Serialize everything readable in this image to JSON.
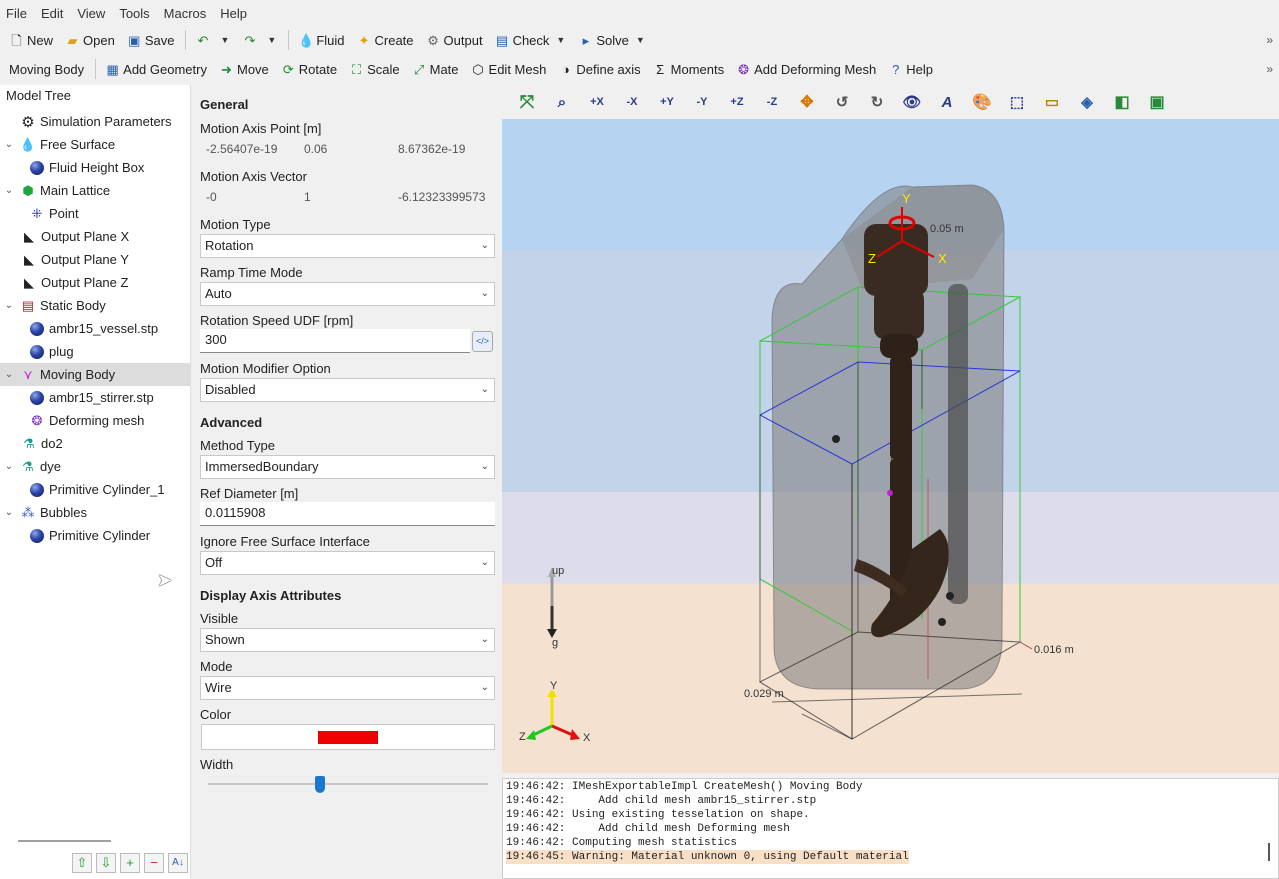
{
  "menu": [
    "File",
    "Edit",
    "View",
    "Tools",
    "Macros",
    "Help"
  ],
  "toolbar1": {
    "new": "New",
    "open": "Open",
    "save": "Save",
    "fluid": "Fluid",
    "create": "Create",
    "output": "Output",
    "check": "Check",
    "solve": "Solve"
  },
  "toolbar2": {
    "context": "Moving Body",
    "add_geometry": "Add Geometry",
    "move": "Move",
    "rotate": "Rotate",
    "scale": "Scale",
    "mate": "Mate",
    "edit_mesh": "Edit Mesh",
    "define_axis": "Define axis",
    "moments": "Moments",
    "add_deforming_mesh": "Add Deforming Mesh",
    "help": "Help"
  },
  "tree": {
    "title": "Model Tree",
    "items": [
      {
        "label": "Simulation Parameters",
        "icon": "gear-icon"
      },
      {
        "label": "Free Surface",
        "icon": "free-surface-icon"
      },
      {
        "label": "Fluid Height Box",
        "icon": "sphere-icon"
      },
      {
        "label": "Main Lattice",
        "icon": "lattice-icon"
      },
      {
        "label": "Point",
        "icon": "point-icon"
      },
      {
        "label": "Output Plane X",
        "icon": "plane-icon"
      },
      {
        "label": "Output Plane Y",
        "icon": "plane-icon"
      },
      {
        "label": "Output Plane Z",
        "icon": "plane-icon"
      },
      {
        "label": "Static Body",
        "icon": "brick-icon"
      },
      {
        "label": "ambr15_vessel.stp",
        "icon": "sphere-icon"
      },
      {
        "label": "plug",
        "icon": "sphere-icon"
      },
      {
        "label": "Moving Body",
        "icon": "moving-body-icon"
      },
      {
        "label": "ambr15_stirrer.stp",
        "icon": "sphere-icon"
      },
      {
        "label": "Deforming mesh",
        "icon": "deforming-mesh-icon"
      },
      {
        "label": "do2",
        "icon": "flask-icon"
      },
      {
        "label": "dye",
        "icon": "flask-icon"
      },
      {
        "label": "Primitive Cylinder_1",
        "icon": "sphere-icon"
      },
      {
        "label": "Bubbles",
        "icon": "bubbles-icon"
      },
      {
        "label": "Primitive Cylinder",
        "icon": "sphere-icon"
      }
    ]
  },
  "props": {
    "general": "General",
    "axis_point_label": "Motion Axis Point [m]",
    "axis_point": [
      "-2.56407e-19",
      "0.06",
      "8.67362e-19"
    ],
    "axis_vector_label": "Motion Axis Vector",
    "axis_vector": [
      "-0",
      "1",
      "-6.12323399573"
    ],
    "motion_type_label": "Motion Type",
    "motion_type": "Rotation",
    "ramp_label": "Ramp Time Mode",
    "ramp": "Auto",
    "speed_label": "Rotation Speed UDF [rpm]",
    "speed": "300",
    "modifier_label": "Motion Modifier Option",
    "modifier": "Disabled",
    "advanced": "Advanced",
    "method_label": "Method Type",
    "method": "ImmersedBoundary",
    "ref_diam_label": "Ref Diameter [m]",
    "ref_diam": "0.0115908",
    "ignore_fs_label": "Ignore Free Surface Interface",
    "ignore_fs": "Off",
    "display": "Display Axis Attributes",
    "visible_label": "Visible",
    "visible": "Shown",
    "mode_label": "Mode",
    "mode": "Wire",
    "color_label": "Color",
    "color": "#ee0000",
    "width_label": "Width",
    "width_level": 0.4
  },
  "viewport": {
    "labels": {
      "dim_top": "0.05 m",
      "dim_right": "0.016 m",
      "dim_left": "0.029 m",
      "up": "up",
      "g": "g",
      "axis_y": "Y",
      "axis_x": "X",
      "axis_z": "Z",
      "triad_y": "Y",
      "triad_x": "X",
      "triad_z": "Z"
    },
    "colors": {
      "top_band": "#b6d3f2",
      "floor": "#f4e1d0",
      "lattice_green": "#35c83a",
      "lattice_blue": "#2c34d8",
      "rotation_axis": "#e00000"
    }
  },
  "log": [
    "19:46:42: IMeshExportableImpl CreateMesh() Moving Body",
    "19:46:42:     Add child mesh ambr15_stirrer.stp",
    "19:46:42: Using existing tesselation on shape.",
    "19:46:42:     Add child mesh Deforming mesh",
    "19:46:42: Computing mesh statistics",
    "19:46:45: Warning: Material unknown 0, using Default material"
  ]
}
